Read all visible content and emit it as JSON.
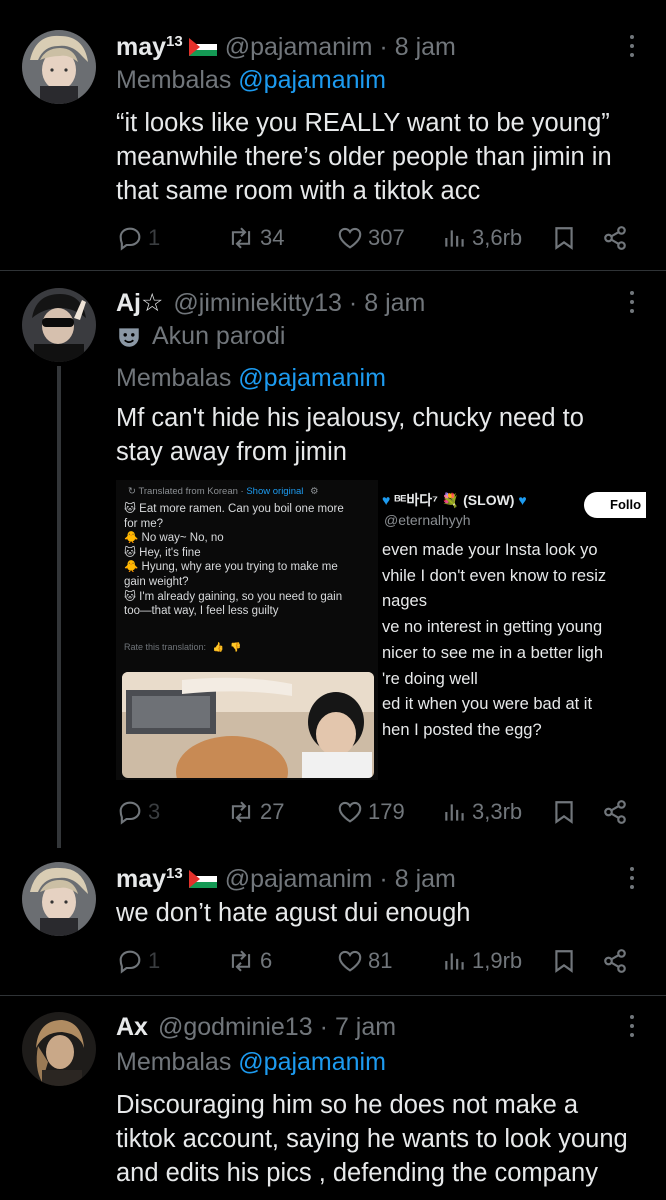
{
  "tweets": [
    {
      "name": "may",
      "name_sup": "13",
      "handle": "@pajamanim",
      "time": "8 jam",
      "reply_prefix": "Membalas",
      "reply_to": "@pajamanim",
      "text_lines": [
        "“it looks like you REALLY want to be young”",
        "meanwhile there’s older people than jimin in",
        "that same room with a tiktok acc"
      ],
      "replies": "1",
      "reposts": "34",
      "likes": "307",
      "views": "3,6rb"
    },
    {
      "name": "Aj",
      "name_symbol": "☆",
      "handle": "@jiminiekitty13",
      "time": "8 jam",
      "parody_label": "Akun parodi",
      "reply_prefix": "Membalas",
      "reply_to": "@pajamanim",
      "text_lines": [
        "Mf can't hide his jealousy, chucky need to",
        "stay away from jimin"
      ],
      "replies": "3",
      "reposts": "27",
      "likes": "179",
      "views": "3,3rb",
      "media": {
        "translated_from": "Translated from Korean",
        "show_original": "Show original",
        "lines": [
          "🐱 Eat more ramen. Can you boil one more",
          "for me?",
          "🐥 No way~ No, no",
          "🐱 Hey, it's fine",
          "🐥 Hyung, why are you trying to make me",
          "gain weight?",
          "🐱 I'm already gaining, so you need to gain",
          "too—that way, I feel less guilty"
        ],
        "rate": "Rate this translation:",
        "quoted_name": "ᴮᴱ바다⁷ 💐 (SLOW)",
        "quoted_handle": "@eternalhyyh",
        "follow_label": "Follo",
        "quoted_lines": [
          "even made your Insta look yo",
          "vhile I don't even know to resiz",
          "nages",
          "ve no interest in getting young",
          "nicer to see me in a better ligh",
          "'re doing well",
          "ed it when you were bad at it",
          "hen I posted the egg?"
        ]
      }
    },
    {
      "name": "may",
      "name_sup": "13",
      "handle": "@pajamanim",
      "time": "8 jam",
      "text_lines": [
        "we don’t hate agust dui enough"
      ],
      "replies": "1",
      "reposts": "6",
      "likes": "81",
      "views": "1,9rb"
    },
    {
      "name": "Ax",
      "handle": "@godminie13",
      "time": "7 jam",
      "reply_prefix": "Membalas",
      "reply_to": "@pajamanim",
      "text_lines": [
        "Discouraging him so he does not make a",
        "tiktok account, saying he wants to look young",
        "and edits his pics , defending the company"
      ]
    }
  ],
  "sep": "·",
  "colors": {
    "bg": "#000000",
    "text": "#e7e9ea",
    "muted": "#71767b",
    "link": "#1d9bf0",
    "divider": "#2f3336"
  }
}
